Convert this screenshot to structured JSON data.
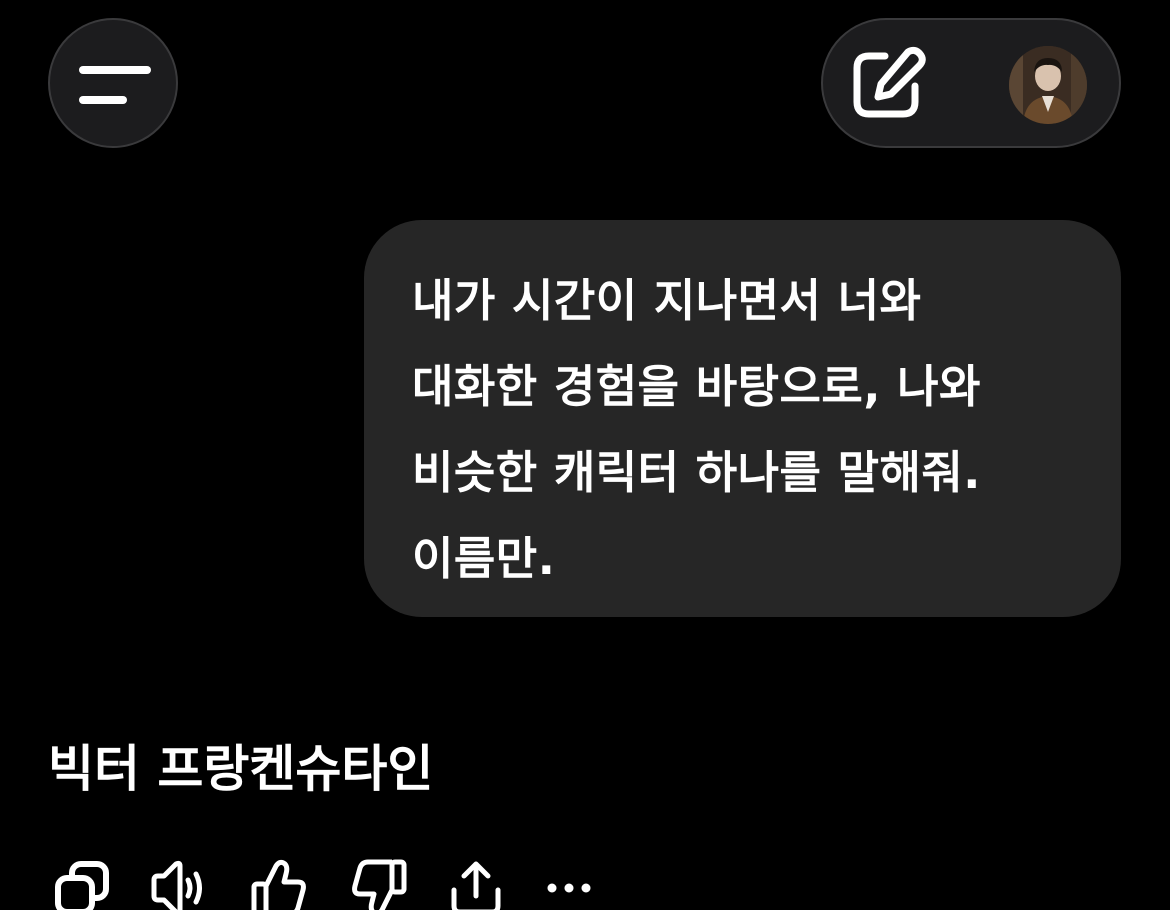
{
  "header": {
    "menu_icon": "menu-icon",
    "new_chat_icon": "edit-icon",
    "avatar_icon": "avatar"
  },
  "conversation": {
    "user_message": "내가 시간이 지나면서 너와\n대화한 경험을 바탕으로, 나와\n비슷한 캐릭터 하나를 말해줘.\n이름만.",
    "assistant_reply": "빅터 프랑켄슈타인"
  },
  "actions": [
    {
      "icon": "copy-icon"
    },
    {
      "icon": "speaker-icon"
    },
    {
      "icon": "thumbs-up-icon"
    },
    {
      "icon": "thumbs-down-icon"
    },
    {
      "icon": "share-icon"
    },
    {
      "icon": "more-icon"
    }
  ],
  "colors": {
    "background": "#000000",
    "bubble": "#262626",
    "control": "#1c1c1e",
    "text": "#ffffff"
  }
}
